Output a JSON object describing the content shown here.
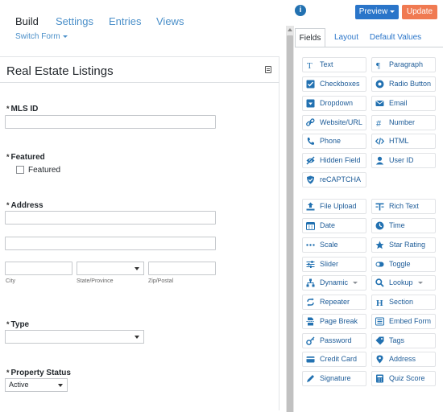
{
  "nav": {
    "tabs": [
      {
        "label": "Build"
      },
      {
        "label": "Settings"
      },
      {
        "label": "Entries"
      },
      {
        "label": "Views"
      }
    ],
    "switch_form": "Switch Form"
  },
  "form": {
    "title": "Real Estate Listings",
    "required_marker": "*",
    "fields": {
      "mls_id": {
        "label": "MLS ID"
      },
      "featured": {
        "label": "Featured",
        "option": "Featured"
      },
      "address": {
        "label": "Address",
        "city": "City",
        "state": "State/Province",
        "zip": "Zip/Postal"
      },
      "type": {
        "label": "Type"
      },
      "property_status": {
        "label": "Property Status",
        "value": "Active"
      }
    }
  },
  "toolbar": {
    "info": "i",
    "preview": "Preview",
    "update": "Update"
  },
  "panel": {
    "tabs": [
      {
        "label": "Fields"
      },
      {
        "label": "Layout"
      },
      {
        "label": "Default Values"
      }
    ],
    "fields": [
      {
        "label": "Text",
        "icon": "text-icon"
      },
      {
        "label": "Paragraph",
        "icon": "paragraph-icon"
      },
      {
        "label": "Checkboxes",
        "icon": "checkbox-icon"
      },
      {
        "label": "Radio Button",
        "icon": "radio-icon"
      },
      {
        "label": "Dropdown",
        "icon": "dropdown-icon"
      },
      {
        "label": "Email",
        "icon": "email-icon"
      },
      {
        "label": "Website/URL",
        "icon": "link-icon"
      },
      {
        "label": "Number",
        "icon": "hash-icon"
      },
      {
        "label": "Phone",
        "icon": "phone-icon"
      },
      {
        "label": "HTML",
        "icon": "code-icon"
      },
      {
        "label": "Hidden Field",
        "icon": "hidden-eye-icon"
      },
      {
        "label": "User ID",
        "icon": "user-icon"
      },
      {
        "label": "reCAPTCHA",
        "icon": "shield-check-icon"
      },
      {
        "label": "File Upload",
        "icon": "upload-icon"
      },
      {
        "label": "Rich Text",
        "icon": "rich-text-icon"
      },
      {
        "label": "Date",
        "icon": "calendar-icon"
      },
      {
        "label": "Time",
        "icon": "clock-icon"
      },
      {
        "label": "Scale",
        "icon": "scale-icon"
      },
      {
        "label": "Star Rating",
        "icon": "star-icon"
      },
      {
        "label": "Slider",
        "icon": "slider-icon"
      },
      {
        "label": "Toggle",
        "icon": "toggle-icon"
      },
      {
        "label": "Dynamic",
        "icon": "hierarchy-icon"
      },
      {
        "label": "Lookup",
        "icon": "search-icon"
      },
      {
        "label": "Repeater",
        "icon": "repeat-icon"
      },
      {
        "label": "Section",
        "icon": "heading-icon"
      },
      {
        "label": "Page Break",
        "icon": "page-break-icon"
      },
      {
        "label": "Embed Form",
        "icon": "embed-icon"
      },
      {
        "label": "Password",
        "icon": "key-icon"
      },
      {
        "label": "Tags",
        "icon": "tag-icon"
      },
      {
        "label": "Credit Card",
        "icon": "credit-card-icon"
      },
      {
        "label": "Address",
        "icon": "map-pin-icon"
      },
      {
        "label": "Signature",
        "icon": "pen-icon"
      },
      {
        "label": "Quiz Score",
        "icon": "calculator-icon"
      }
    ]
  },
  "colors": {
    "link": "#4a8fc9",
    "primary": "#2a75c9",
    "update": "#f07a52",
    "icon": "#2271b1"
  }
}
